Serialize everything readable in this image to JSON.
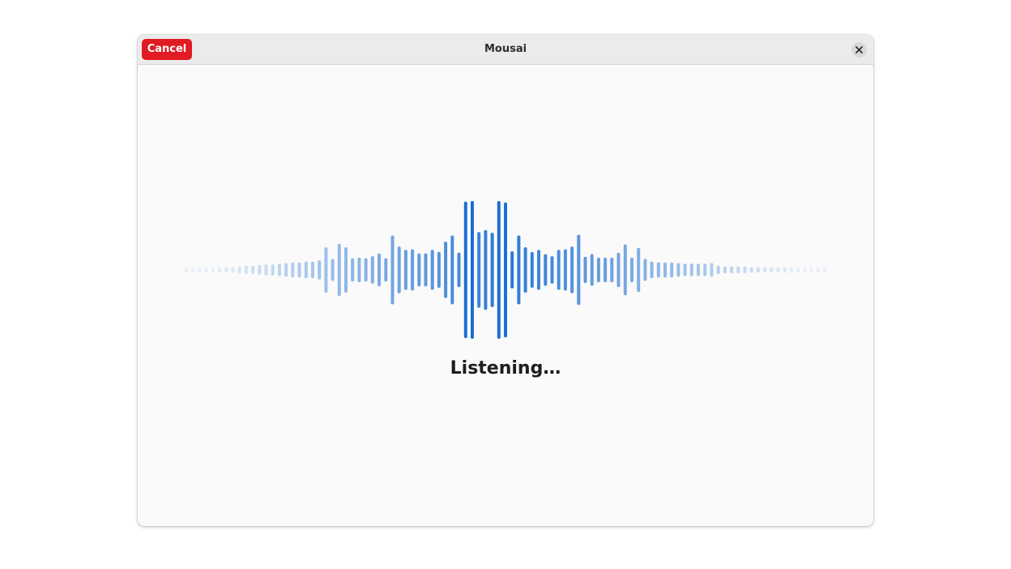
{
  "window": {
    "title": "Mousai"
  },
  "headerbar": {
    "cancel_label": "Cancel",
    "close_icon": "close-icon"
  },
  "main": {
    "status_text": "Listening…",
    "waveform_icon": "audio-waveform",
    "waveform_color": "#1c6fd4",
    "bar_levels": [
      0.04,
      0.04,
      0.04,
      0.04,
      0.04,
      0.04,
      0.04,
      0.04,
      0.05,
      0.06,
      0.06,
      0.07,
      0.08,
      0.08,
      0.09,
      0.1,
      0.11,
      0.11,
      0.12,
      0.12,
      0.14,
      0.33,
      0.16,
      0.38,
      0.33,
      0.17,
      0.18,
      0.17,
      0.2,
      0.24,
      0.17,
      0.5,
      0.34,
      0.29,
      0.3,
      0.24,
      0.24,
      0.29,
      0.26,
      0.41,
      0.5,
      0.25,
      0.99,
      1.0,
      0.55,
      0.58,
      0.54,
      1.0,
      0.98,
      0.27,
      0.5,
      0.33,
      0.26,
      0.29,
      0.23,
      0.2,
      0.29,
      0.3,
      0.34,
      0.51,
      0.19,
      0.23,
      0.18,
      0.18,
      0.18,
      0.25,
      0.37,
      0.18,
      0.32,
      0.16,
      0.12,
      0.11,
      0.11,
      0.11,
      0.1,
      0.09,
      0.09,
      0.09,
      0.09,
      0.1,
      0.06,
      0.05,
      0.05,
      0.05,
      0.05,
      0.04,
      0.04,
      0.04,
      0.04,
      0.04,
      0.04,
      0.04,
      0.04,
      0.04,
      0.04,
      0.04,
      0.04
    ]
  }
}
